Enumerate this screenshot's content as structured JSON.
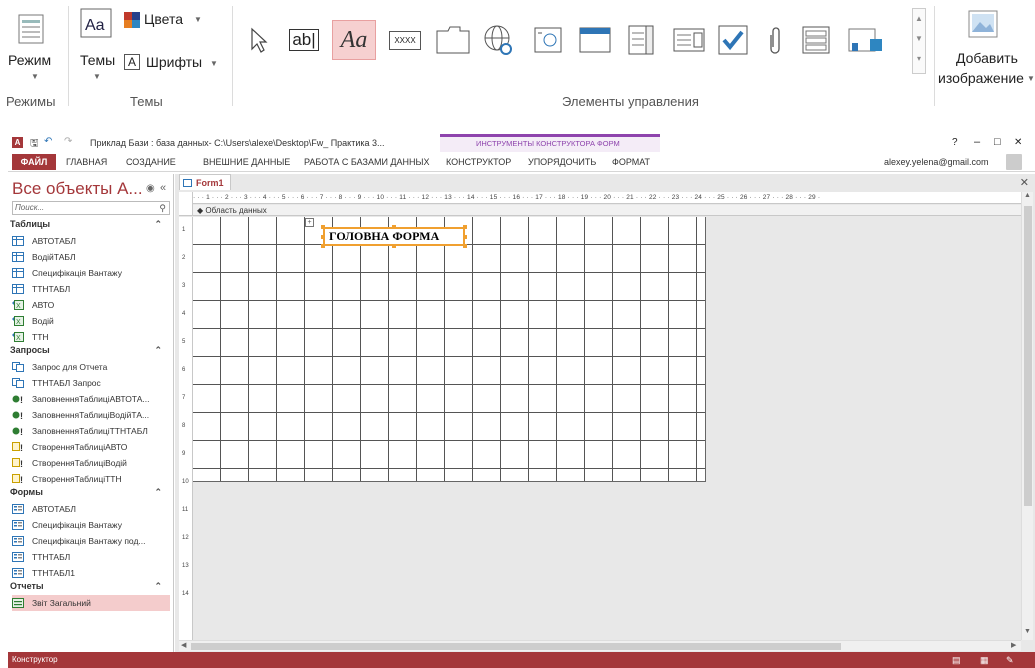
{
  "ribbon": {
    "mode_label": "Режим",
    "modes_group": "Режимы",
    "themes_label": "Темы",
    "colors_label": "Цвета",
    "fonts_label": "Шрифты",
    "themes_group": "Темы",
    "controls_group": "Элементы управления",
    "textbox_glyph": "ab|",
    "label_glyph": "Aa",
    "button_glyph": "XXXX",
    "add_image_line1": "Добавить",
    "add_image_line2": "изображение"
  },
  "titlebar": {
    "title": "Приклад Бази : база данных- C:\\Users\\alexe\\Desktop\\Fw_ Практика 3...",
    "context_tools": "ИНСТРУМЕНТЫ КОНСТРУКТОРА ФОРМ",
    "help": "?",
    "minimize": "–",
    "restore": "□",
    "close": "✕"
  },
  "tabs": {
    "file": "ФАЙЛ",
    "home": "ГЛАВНАЯ",
    "create": "СОЗДАНИЕ",
    "external": "ВНЕШНИЕ ДАННЫЕ",
    "database": "РАБОТА С БАЗАМИ ДАННЫХ",
    "design": "КОНСТРУКТОР",
    "arrange": "УПОРЯДОЧИТЬ",
    "format": "ФОРМАТ",
    "user": "alexey.yelena@gmail.com"
  },
  "nav": {
    "title": "Все объекты А...",
    "search_placeholder": "Поиск...",
    "sections": [
      {
        "label": "Таблицы",
        "items": [
          "АВТОТАБЛ",
          "ВодійТАБЛ",
          "Специфікація Вантажу",
          "ТТНТАБЛ",
          "АВТО",
          "Водій",
          "ТТН"
        ]
      },
      {
        "label": "Запросы",
        "items": [
          "Запрос для Отчета",
          "ТТНТАБЛ Запрос",
          "ЗаповненняТаблиціАВТОТА...",
          "ЗаповненняТаблиціВодійТА...",
          "ЗаповненняТаблиціТТНТАБЛ",
          "СтворенняТаблиціАВТО",
          "СтворенняТаблиціВодій",
          "СтворенняТаблиціТТН"
        ]
      },
      {
        "label": "Формы",
        "items": [
          "АВТОТАБЛ",
          "Специфікація Вантажу",
          "Специфікація Вантажу под...",
          "ТТНТАБЛ",
          "ТТНТАБЛ1"
        ]
      },
      {
        "label": "Отчеты",
        "items": [
          "Звіт Загальний"
        ]
      }
    ]
  },
  "doc": {
    "tab_label": "Form1",
    "section_label": "Область данных",
    "form_label": "ГОЛОВНА ФОРМА",
    "ruler_text": "· · · 1 · · · 2 · · · 3 · · · 4 · · · 5 · · · 6 · · · 7 · · · 8 · · · 9 · · · 10 · · · 11 · · · 12 · · · 13 · · · 14 · · · 15 · · · 16 · · · 17 · · · 18 · · · 19 · · · 20 · · · 21 · · · 22 · · · 23 · · · 24 · · · 25 · · · 26 · · · 27 · · · 28 · · · 29 ·",
    "vruler_numbers": [
      "1",
      "2",
      "3",
      "4",
      "5",
      "6",
      "7",
      "8",
      "9",
      "10",
      "11",
      "12",
      "13",
      "14"
    ]
  },
  "status": {
    "text": "Конструктор"
  },
  "colors": {
    "accent": "#a4373a",
    "selection": "#f0a030",
    "context_tab": "#8e44ad"
  }
}
